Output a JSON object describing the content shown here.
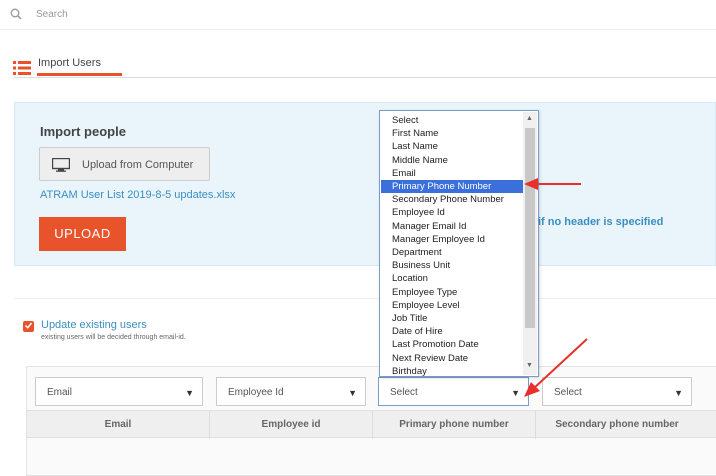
{
  "search": {
    "placeholder": "Search",
    "icon": "search-icon"
  },
  "tabs": [
    {
      "label": "Import Users",
      "icon": "list-icon",
      "active": true
    }
  ],
  "import_panel": {
    "title": "Import people",
    "upload_computer_label": "Upload from Computer",
    "file_name": "ATRAM User List 2019-8-5 updates.xlsx",
    "upload_button": "UPLOAD",
    "header_note": "if no header is specified"
  },
  "update_existing": {
    "checked": true,
    "label": "Update existing users",
    "sublabel": "existing users will be decided through email-id."
  },
  "mapping_row": {
    "selects": [
      "Email",
      "Employee Id",
      "Select",
      "Select"
    ]
  },
  "table": {
    "headers": [
      "Email",
      "Employee id",
      "Primary phone number",
      "Secondary phone number"
    ]
  },
  "dropdown": {
    "options": [
      "Select",
      "First Name",
      "Last Name",
      "Middle Name",
      "Email",
      "Primary Phone Number",
      "Secondary Phone Number",
      "Employee Id",
      "Manager Email Id",
      "Manager Employee Id",
      "Department",
      "Business Unit",
      "Location",
      "Employee Type",
      "Employee Level",
      "Job Title",
      "Date of Hire",
      "Last Promotion Date",
      "Next Review Date",
      "Birthday"
    ],
    "selected": "Primary Phone Number"
  },
  "colors": {
    "accent": "#e8532b",
    "link": "#3a8ebf",
    "panel_bg": "#eaf5fb",
    "selection": "#3a6fdc"
  }
}
